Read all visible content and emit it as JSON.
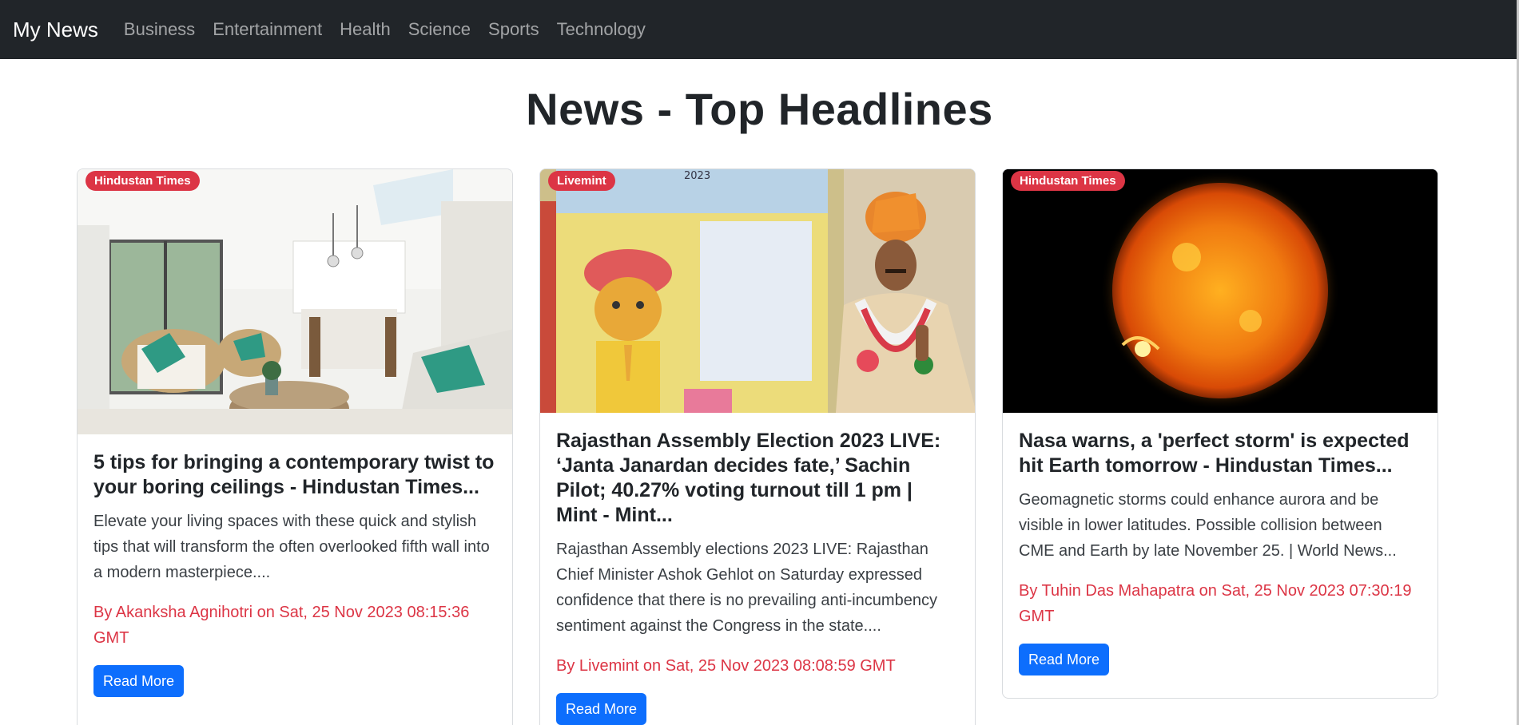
{
  "navbar": {
    "brand": "My News",
    "links": [
      "Business",
      "Entertainment",
      "Health",
      "Science",
      "Sports",
      "Technology"
    ]
  },
  "page": {
    "heading": "News - Top Headlines"
  },
  "articles": [
    {
      "source": "Hindustan Times",
      "title": "5 tips for bringing a contemporary twist to your boring ceilings - Hindustan Times...",
      "description": "Elevate your living spaces with these quick and stylish tips that will transform the often overlooked fifth wall into a modern masterpiece....",
      "meta": "By Akanksha Agnihotri on Sat, 25 Nov 2023 08:15:36 GMT",
      "button": "Read More",
      "image_icon": "living-room-photo"
    },
    {
      "source": "Livemint",
      "title": "Rajasthan Assembly Election 2023 LIVE: ‘Janta Janardan decides fate,’ Sachin Pilot; 40.27% voting turnout till 1 pm | Mint - Mint...",
      "description": "Rajasthan Assembly elections 2023 LIVE: Rajasthan Chief Minister Ashok Gehlot on Saturday expressed confidence that there is no prevailing anti-incumbency sentiment against the Congress in the state....",
      "meta": "By Livemint on Sat, 25 Nov 2023 08:08:59 GMT",
      "button": "Read More",
      "image_icon": "voter-photo",
      "image_text": "2023"
    },
    {
      "source": "Hindustan Times",
      "title": "Nasa warns, a 'perfect storm' is expected hit Earth tomorrow - Hindustan Times...",
      "description": "Geomagnetic storms could enhance aurora and be visible in lower latitudes. Possible collision between CME and Earth by late November 25. | World News...",
      "meta": "By Tuhin Das Mahapatra on Sat, 25 Nov 2023 07:30:19 GMT",
      "button": "Read More",
      "image_icon": "sun-photo"
    }
  ],
  "colors": {
    "navbar_bg": "#212529",
    "badge": "#dc3545",
    "meta_text": "#dc3545",
    "button": "#0d6efd"
  }
}
